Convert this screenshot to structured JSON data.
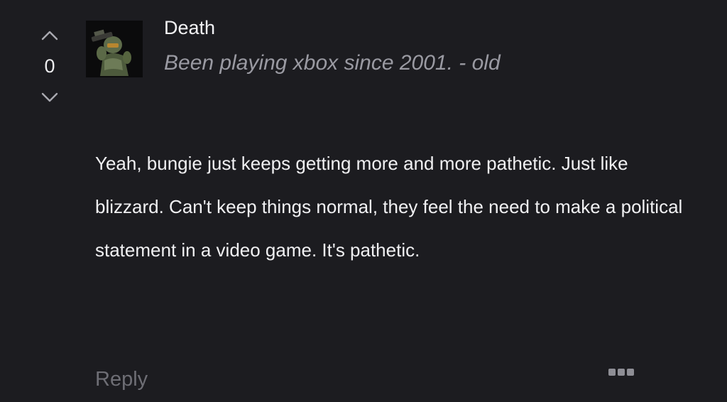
{
  "vote": {
    "count": "0",
    "up_icon": "chevron-up-icon",
    "down_icon": "chevron-down-icon"
  },
  "author": {
    "name": "Death",
    "subtitle": "Been playing xbox since 2001. - old",
    "avatar_icon": "soldier-avatar"
  },
  "comment": {
    "text": "Yeah, bungie just keeps getting more and more pathetic. Just like blizzard. Can't keep things normal, they feel the need to make a political statement in a video game. It's pathetic."
  },
  "actions": {
    "reply_label": "Reply",
    "more_icon": "more-options-icon"
  },
  "colors": {
    "background": "#1c1c20",
    "text": "#f0f0f2",
    "muted": "#9a9aa2",
    "reply": "#6e6e75"
  }
}
